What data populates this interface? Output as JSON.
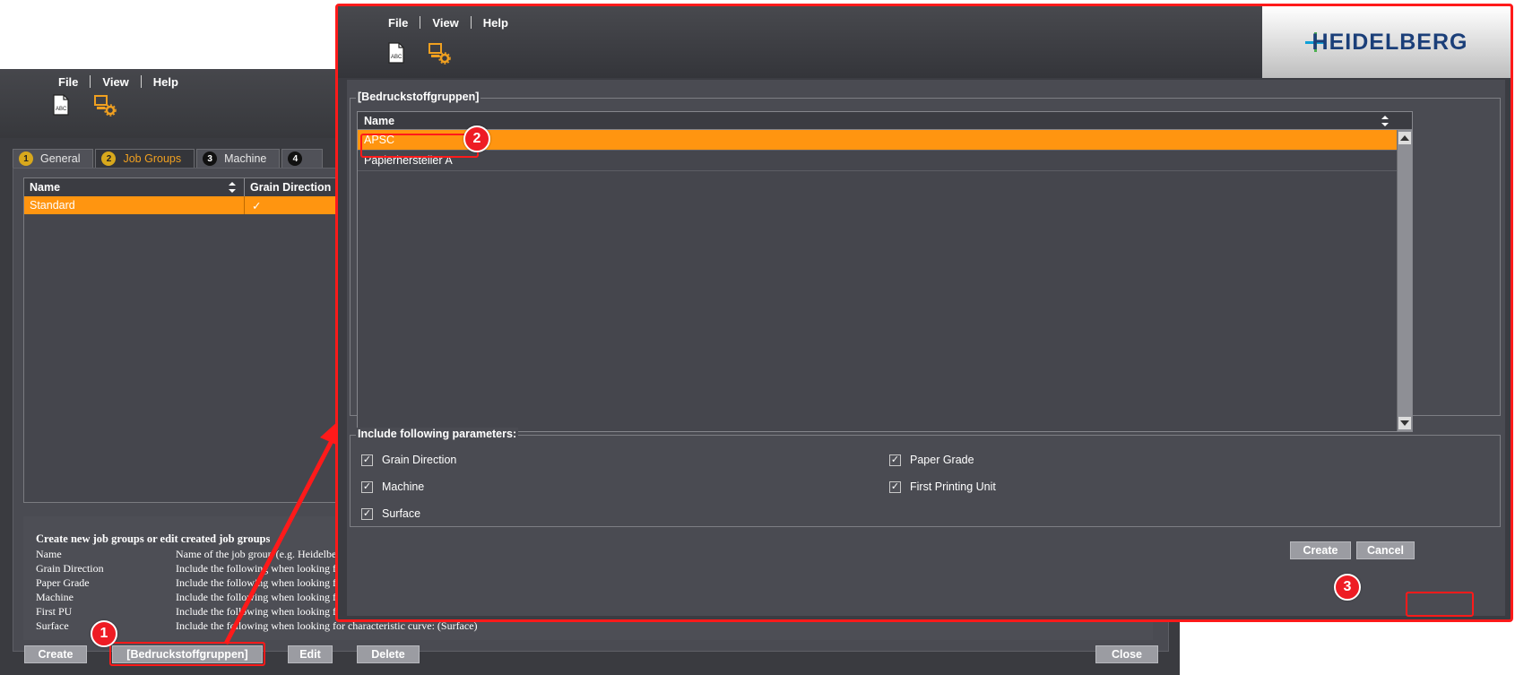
{
  "background_window": {
    "menu": [
      "File",
      "View",
      "Help"
    ],
    "tabs": [
      {
        "num": "1",
        "label": "General"
      },
      {
        "num": "2",
        "label": "Job Groups"
      },
      {
        "num": "3",
        "label": "Machine"
      },
      {
        "num": "4",
        "label": ""
      }
    ],
    "table": {
      "columns": [
        "Name",
        "Grain Direction"
      ],
      "rows": [
        {
          "name": "Standard",
          "grain": "✓"
        }
      ]
    },
    "info": {
      "title": "Create new job groups or edit created job groups",
      "rows": [
        {
          "k": "Name",
          "v": "Name of the job group (e.g. Heidelberg"
        },
        {
          "k": "Grain Direction",
          "v": "Include the following when looking for"
        },
        {
          "k": "Paper Grade",
          "v": "Include the following when looking for"
        },
        {
          "k": "Machine",
          "v": "Include the following when looking for"
        },
        {
          "k": "First PU",
          "v": "Include the following when looking for"
        },
        {
          "k": "Surface",
          "v": "Include the following when looking for characteristic curve: (Surface)"
        }
      ]
    },
    "buttons": {
      "create": "Create",
      "group": "[Bedruckstoffgruppen]",
      "edit": "Edit",
      "delete": "Delete",
      "close": "Close"
    }
  },
  "dialog": {
    "menu": [
      "File",
      "View",
      "Help"
    ],
    "logo_text": "HEIDELBERG",
    "group_label": "[Bedruckstoffgruppen]",
    "table": {
      "column": "Name",
      "rows": [
        "APSC",
        "Papierhersteller A"
      ]
    },
    "params_label": "Include following parameters:",
    "params": [
      {
        "label": "Grain Direction",
        "checked": true
      },
      {
        "label": "Paper Grade",
        "checked": true
      },
      {
        "label": "Machine",
        "checked": true
      },
      {
        "label": "First Printing Unit",
        "checked": true
      },
      {
        "label": "Surface",
        "checked": true
      }
    ],
    "buttons": {
      "create": "Create",
      "cancel": "Cancel"
    }
  },
  "annotations": {
    "m1": "1",
    "m2": "2",
    "m3": "3"
  },
  "colors": {
    "accent": "#ff9510",
    "annotation": "#ee1c24",
    "logo": "#1b3f79"
  }
}
